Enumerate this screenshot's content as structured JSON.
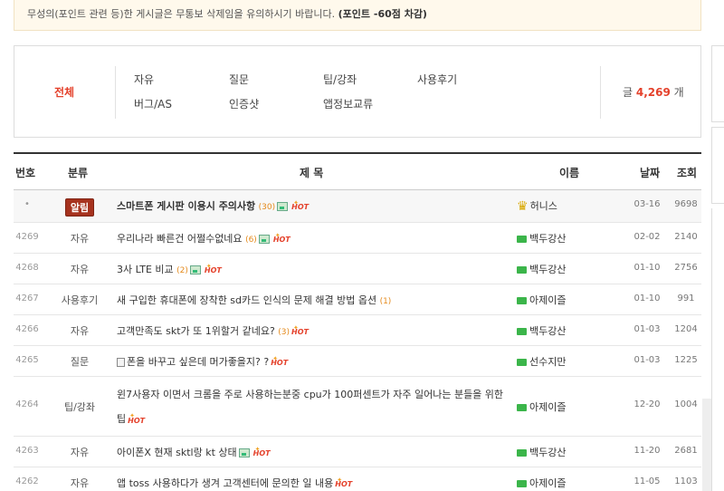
{
  "notice": {
    "text": "무성의(포인트 관련 등)한 게시글은 무통보 삭제임을 유의하시기 바랍니다.",
    "bold": "(포인트 -60점 차감)"
  },
  "categories": {
    "all": "전체",
    "items": [
      "자유",
      "질문",
      "팁/강좌",
      "사용후기",
      "버그/AS",
      "인증샷",
      "앱정보교류"
    ],
    "total_prefix": "글",
    "total_count": "4,269",
    "total_suffix": "개"
  },
  "table": {
    "headers": {
      "num": "번호",
      "cat": "분류",
      "title": "제 목",
      "name": "이름",
      "date": "날짜",
      "hits": "조회"
    },
    "notice_badge": "알림",
    "hot_label": "HOT",
    "rows": [
      {
        "num": "•",
        "cat": "",
        "title": "스마트폰 게시판 이용시 주의사항",
        "comments": "(30)",
        "img": true,
        "hot": true,
        "name": "허니스",
        "date": "03-16",
        "hits": "9698",
        "notice": true
      },
      {
        "num": "4269",
        "cat": "자유",
        "title": "우리나라 빠른건 어쩔수없네요",
        "comments": "(6)",
        "img": true,
        "hot": true,
        "name": "백두강산",
        "date": "02-02",
        "hits": "2140"
      },
      {
        "num": "4268",
        "cat": "자유",
        "title": "3사 LTE 비교",
        "comments": "(2)",
        "img": true,
        "hot": true,
        "name": "백두강산",
        "date": "01-10",
        "hits": "2756"
      },
      {
        "num": "4267",
        "cat": "사용후기",
        "title": "새 구입한 휴대폰에 장착한 sd카드 인식의 문제 해결 방법 옵션",
        "comments": "(1)",
        "img": false,
        "hot": false,
        "name": "아제이즐",
        "date": "01-10",
        "hits": "991"
      },
      {
        "num": "4266",
        "cat": "자유",
        "title": "고객만족도 skt가 또 1위할거 같네요?",
        "comments": "(3)",
        "img": false,
        "hot": true,
        "name": "백두강산",
        "date": "01-03",
        "hits": "1204"
      },
      {
        "num": "4265",
        "cat": "질문",
        "title": "폰을 바꾸고 싶은데 머가좋을지? ?",
        "comments": "",
        "img": false,
        "hot": true,
        "name": "선수지만",
        "date": "01-03",
        "hits": "1225",
        "doc": true
      },
      {
        "num": "4264",
        "cat": "팁/강좌",
        "title": "윈7사용자 이면서 크롬을 주로 사용하는분중 cpu가 100퍼센트가 자주 일어나는 분들을 위한 팁",
        "comments": "",
        "img": false,
        "hot": true,
        "name": "아제이즐",
        "date": "12-20",
        "hits": "1004",
        "tall": true
      },
      {
        "num": "4263",
        "cat": "자유",
        "title": "아이폰X 현재 sktl랑 kt 상태",
        "comments": "",
        "img": true,
        "hot": true,
        "name": "백두강산",
        "date": "11-20",
        "hits": "2681"
      },
      {
        "num": "4262",
        "cat": "자유",
        "title": "앱 toss 사용하다가 생겨 고객센터에 문의한 일 내용",
        "comments": "",
        "img": false,
        "hot": true,
        "name": "아제이즐",
        "date": "11-05",
        "hits": "1103"
      }
    ]
  }
}
